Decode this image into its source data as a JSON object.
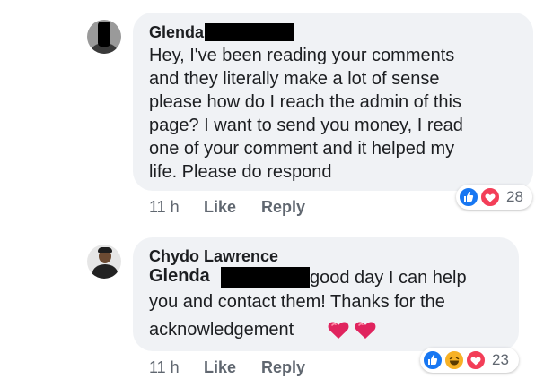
{
  "comment1": {
    "author": "Glenda",
    "lines": [
      "Hey, I've been reading your comments",
      "and they literally make a lot of sense",
      "please how do I reach the admin of this",
      "page? I want to send you money, I read",
      "one of your comment and it helped my",
      "life. Please do respond"
    ],
    "time": "11 h",
    "like_label": "Like",
    "reply_label": "Reply",
    "reaction_count": "28",
    "reactions": [
      "like-icon",
      "love-icon"
    ]
  },
  "comment2": {
    "author": "Chydo Lawrence",
    "mention": "Glenda",
    "line1": "good day I can help",
    "line2": "you and contact them! Thanks for the",
    "line3": "acknowledgement",
    "emoji": [
      "heart-emoji",
      "heart-emoji"
    ],
    "time": "11 h",
    "like_label": "Like",
    "reply_label": "Reply",
    "reaction_count": "23",
    "reactions": [
      "like-icon",
      "haha-icon",
      "love-icon"
    ]
  },
  "colors": {
    "bubble": "#f0f2f5",
    "like_blue": "#1877f2",
    "love_red": "#f33e58",
    "haha_yellow": "#f7b125",
    "meta_gray": "#606770"
  }
}
